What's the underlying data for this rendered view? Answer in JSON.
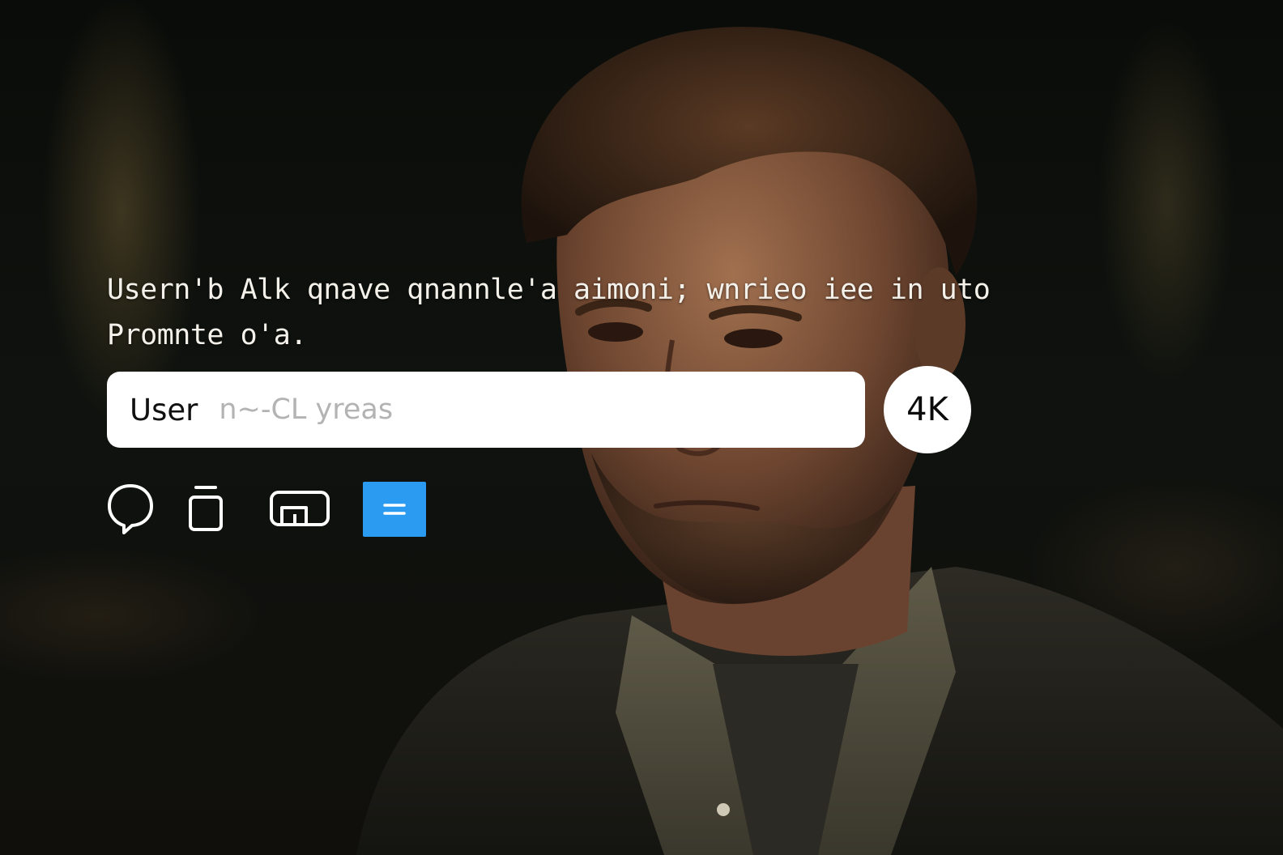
{
  "prompt": {
    "line1": "Usern'b Alk qnave qnannle'a aimoni; wnrieo iee in uto",
    "line2": "Promnte o'a."
  },
  "input": {
    "label": "User",
    "placeholder": "n~-CL yreas",
    "value": ""
  },
  "resolution_button": {
    "label": "4K"
  },
  "toolbar": {
    "items": [
      {
        "name": "chat",
        "icon": "chat-bubble-icon"
      },
      {
        "name": "copy",
        "icon": "copy-icon"
      },
      {
        "name": "layout",
        "icon": "layout-icon"
      },
      {
        "name": "menu",
        "icon": "equals-menu-icon",
        "active": true
      }
    ],
    "active_color": "#2a9bf0"
  },
  "colors": {
    "text": "#f4f1ea",
    "input_background": "#ffffff",
    "background": "#0b0c09"
  }
}
